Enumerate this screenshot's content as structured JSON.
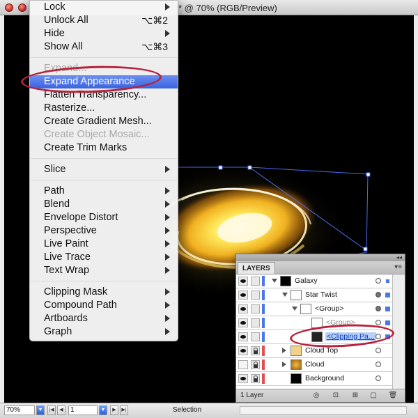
{
  "window": {
    "title": "* @ 70% (RGB/Preview)"
  },
  "menu": {
    "items": [
      {
        "label": "Lock",
        "submenu": true
      },
      {
        "label": "Unlock All",
        "shortcut": "⌥⌘2"
      },
      {
        "label": "Hide",
        "submenu": true
      },
      {
        "label": "Show All",
        "shortcut": "⌥⌘3"
      },
      {
        "label": "Expand...",
        "disabled": true
      },
      {
        "label": "Expand Appearance",
        "selected": true
      },
      {
        "label": "Flatten Transparency..."
      },
      {
        "label": "Rasterize..."
      },
      {
        "label": "Create Gradient Mesh..."
      },
      {
        "label": "Create Object Mosaic...",
        "disabled": true
      },
      {
        "label": "Create Trim Marks"
      },
      {
        "label": "Slice",
        "submenu": true
      },
      {
        "label": "Path",
        "submenu": true
      },
      {
        "label": "Blend",
        "submenu": true
      },
      {
        "label": "Envelope Distort",
        "submenu": true
      },
      {
        "label": "Perspective",
        "submenu": true
      },
      {
        "label": "Live Paint",
        "submenu": true
      },
      {
        "label": "Live Trace",
        "submenu": true
      },
      {
        "label": "Text Wrap",
        "submenu": true
      },
      {
        "label": "Clipping Mask",
        "submenu": true
      },
      {
        "label": "Compound Path",
        "submenu": true
      },
      {
        "label": "Artboards",
        "submenu": true
      },
      {
        "label": "Graph",
        "submenu": true
      }
    ]
  },
  "layers_panel": {
    "tab": "LAYERS",
    "rows": [
      {
        "name": "Galaxy",
        "color": "#4a78e8",
        "expanded": true
      },
      {
        "name": "Star Twist",
        "color": "#4a78e8",
        "expanded": true
      },
      {
        "name": "<Group>",
        "color": "#4a78e8",
        "expanded": true
      },
      {
        "name": "<Group>",
        "color": "#4a78e8"
      },
      {
        "name": "<Clipping Pa...",
        "color": "#4a78e8",
        "active": true
      },
      {
        "name": "Cloud Top",
        "color": "#e05050",
        "locked": true
      },
      {
        "name": "Cloud",
        "color": "#e05050",
        "locked": true
      },
      {
        "name": "Background",
        "color": "#e05050",
        "locked": true
      }
    ],
    "count": "1 Layer"
  },
  "statusbar": {
    "zoom": "70%",
    "page": "1",
    "status": "Selection"
  },
  "colors": {
    "menu_highlight": "#3a63e0",
    "annotation": "#b8223b",
    "selection_handles": "#4a6cf0"
  }
}
